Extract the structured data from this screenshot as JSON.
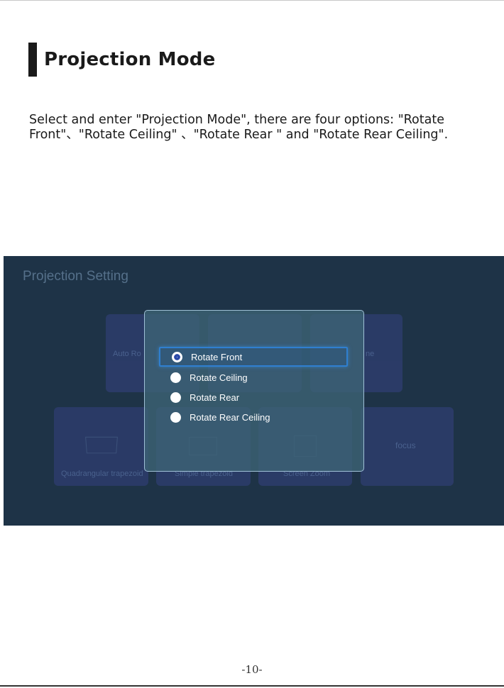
{
  "heading": {
    "title": "Projection Mode"
  },
  "description": "Select and enter \"Projection Mode\", there are four options: \"Rotate Front\"、\"Rotate Ceiling\" 、\"Rotate Rear \" and \"Rotate Rear Ceiling\".",
  "screen": {
    "title": "Projection Setting",
    "tiles": {
      "auto_rotate_label": "Auto Ro",
      "tile_right_label": "ne",
      "quadrangular_label": "Quadrangular trapezoid",
      "simple_label": "Simple trapezoid",
      "zoom_label": "Screen Zoom",
      "focus_label": "focus"
    },
    "dialog": {
      "options": [
        {
          "label": "Rotate Front",
          "selected": true
        },
        {
          "label": "Rotate Ceiling",
          "selected": false
        },
        {
          "label": "Rotate Rear",
          "selected": false
        },
        {
          "label": "Rotate Rear Ceiling",
          "selected": false
        }
      ]
    }
  },
  "footer": {
    "page_number": "-10-"
  },
  "colors": {
    "screen_bg": "#1e3347",
    "tile": "#2c3c6a",
    "selection": "#2f7fd0"
  }
}
